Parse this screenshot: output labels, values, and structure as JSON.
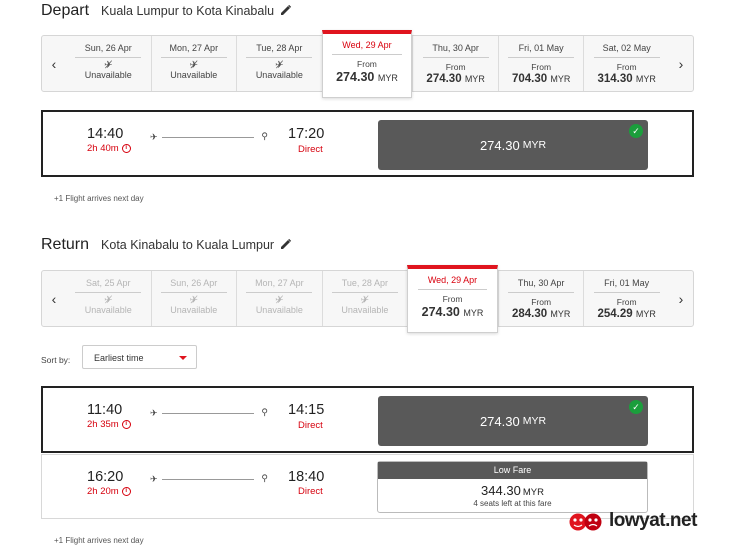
{
  "depart": {
    "label": "Depart",
    "route": "Kuala Lumpur to Kota Kinabalu",
    "dates": [
      {
        "label": "Sun, 26 Apr",
        "status": "Unavailable"
      },
      {
        "label": "Mon, 27 Apr",
        "status": "Unavailable"
      },
      {
        "label": "Tue, 28 Apr",
        "status": "Unavailable"
      },
      {
        "label": "Wed, 29 Apr",
        "from": "From",
        "price": "274.30",
        "currency": "MYR"
      },
      {
        "label": "Thu, 30 Apr",
        "from": "From",
        "price": "274.30",
        "currency": "MYR"
      },
      {
        "label": "Fri, 01 May",
        "from": "From",
        "price": "704.30",
        "currency": "MYR"
      },
      {
        "label": "Sat, 02 May",
        "from": "From",
        "price": "314.30",
        "currency": "MYR"
      }
    ],
    "flights": [
      {
        "depart_time": "14:40",
        "duration": "2h 40m",
        "arrive_time": "17:20",
        "stops": "Direct",
        "price": "274.30",
        "currency": "MYR"
      }
    ],
    "note": "+1 Flight arrives next day"
  },
  "return": {
    "label": "Return",
    "route": "Kota Kinabalu to Kuala Lumpur",
    "dates": [
      {
        "label": "Sat, 25 Apr",
        "status": "Unavailable"
      },
      {
        "label": "Sun, 26 Apr",
        "status": "Unavailable"
      },
      {
        "label": "Mon, 27 Apr",
        "status": "Unavailable"
      },
      {
        "label": "Tue, 28 Apr",
        "status": "Unavailable"
      },
      {
        "label": "Wed, 29 Apr",
        "from": "From",
        "price": "274.30",
        "currency": "MYR"
      },
      {
        "label": "Thu, 30 Apr",
        "from": "From",
        "price": "284.30",
        "currency": "MYR"
      },
      {
        "label": "Fri, 01 May",
        "from": "From",
        "price": "254.29",
        "currency": "MYR"
      }
    ],
    "sort_label": "Sort by:",
    "sort_value": "Earliest time",
    "flights": [
      {
        "depart_time": "11:40",
        "duration": "2h 35m",
        "arrive_time": "14:15",
        "stops": "Direct",
        "price": "274.30",
        "currency": "MYR"
      },
      {
        "depart_time": "16:20",
        "duration": "2h 20m",
        "arrive_time": "18:40",
        "stops": "Direct",
        "fare_label": "Low Fare",
        "price": "344.30",
        "currency": "MYR",
        "seats_note": "4 seats left at this fare"
      }
    ],
    "note": "+1 Flight arrives next day"
  },
  "icons": {
    "prev": "chevron-left-icon",
    "next": "chevron-right-icon",
    "edit": "pencil-icon",
    "plane": "plane-icon",
    "pin": "location-pin-icon",
    "info": "info-icon",
    "check": "checkmark-icon",
    "unavailable": "plane-crossed-icon"
  },
  "watermark": "lowyat.net",
  "colors": {
    "accent": "#e0141e",
    "price_button": "#595959",
    "selected_check": "#1b9e3c",
    "duration_red": "#d6000d"
  }
}
